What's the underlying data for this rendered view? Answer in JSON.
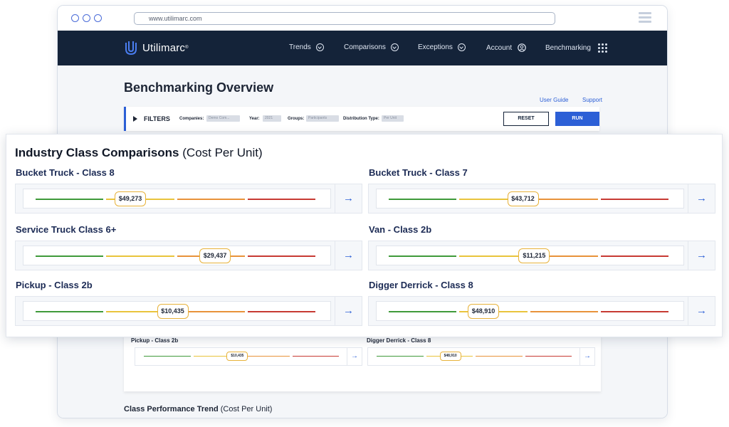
{
  "browser": {
    "url": "www.utilimarc.com"
  },
  "nav": {
    "brand": "Utilimarc",
    "items": [
      {
        "label": "Trends",
        "icon": "chevron-down-circle-icon"
      },
      {
        "label": "Comparisons",
        "icon": "chevron-down-circle-icon"
      },
      {
        "label": "Exceptions",
        "icon": "chevron-down-circle-icon"
      },
      {
        "label": "Account",
        "icon": "user-circle-icon"
      },
      {
        "label": "Benchmarking",
        "icon": "grid-dots-icon"
      }
    ]
  },
  "page": {
    "title": "Benchmarking Overview",
    "user_guide": "User Guide",
    "support": "Support"
  },
  "filters": {
    "label": "FILTERS",
    "companies_key": "Companies:",
    "companies_value": "Demo Com...",
    "year_key": "Year:",
    "year_value": "2021",
    "groups_key": "Groups:",
    "groups_value": "Participants",
    "dist_key": "Distribution Type:",
    "dist_value": "Per Unit",
    "reset": "RESET",
    "run": "RUN"
  },
  "background_cards": [
    {
      "name": "Pickup - Class 2b",
      "value": "$10,435",
      "position": 0.48
    },
    {
      "name": "Digger Derrick - Class 8",
      "value": "$48,910",
      "position": 0.38
    }
  ],
  "trend": {
    "title": "Class Performance Trend",
    "subtitle": "(Cost Per Unit)"
  },
  "comparison": {
    "title": "Industry Class Comparisons",
    "subtitle": "(Cost Per Unit)",
    "colors": {
      "low": "#3f9a3a",
      "mid": "#e9c43c",
      "high_mid": "#e8923a",
      "high": "#c73a33",
      "accent": "#2c5fd6"
    },
    "classes": [
      {
        "name": "Bucket Truck - Class 8",
        "value": "$49,273",
        "position": 0.34
      },
      {
        "name": "Bucket Truck - Class 7",
        "value": "$43,712",
        "position": 0.48
      },
      {
        "name": "Service Truck Class 6+",
        "value": "$29,437",
        "position": 0.64
      },
      {
        "name": "Van - Class 2b",
        "value": "$11,215",
        "position": 0.52
      },
      {
        "name": "Pickup - Class 2b",
        "value": "$10,435",
        "position": 0.49
      },
      {
        "name": "Digger Derrick - Class 8",
        "value": "$48,910",
        "position": 0.34
      }
    ]
  }
}
